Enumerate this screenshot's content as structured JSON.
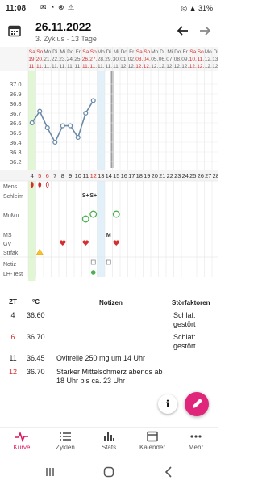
{
  "status": {
    "time": "11:08",
    "icons": "✉ ◔ ⊗ ⚠",
    "right": "◎ ▲ 31%"
  },
  "header": {
    "date": "26.11.2022",
    "subtitle": "3. Zyklus · 13 Tage"
  },
  "chart": {
    "weekdays": [
      "Sa",
      "So",
      "Mo",
      "Di",
      "Mi",
      "Do",
      "Fr",
      "Sa",
      "So",
      "Mo",
      "Di",
      "Mi",
      "Do",
      "Fr",
      "Sa",
      "So",
      "Mo",
      "Di",
      "Mi",
      "Do",
      "Fr",
      "Sa",
      "So",
      "Mo",
      "Di",
      "Mi"
    ],
    "dates": [
      "19.",
      "20.",
      "21.",
      "22.",
      "23.",
      "24.",
      "25.",
      "26.",
      "27.",
      "28.",
      "29.",
      "30.",
      "01.",
      "02.",
      "03.",
      "04.",
      "05.",
      "06.",
      "07.",
      "08.",
      "09.",
      "10.",
      "11.",
      "12.",
      "13.",
      "14."
    ],
    "months": [
      "11.",
      "11.",
      "11.",
      "11.",
      "11.",
      "11.",
      "11.",
      "11.",
      "11.",
      "11.",
      "11.",
      "11.",
      "12.",
      "12.",
      "12.",
      "12.",
      "12.",
      "12.",
      "12.",
      "12.",
      "12.",
      "12.",
      "12.",
      "12.",
      "12.",
      "12."
    ],
    "y_ticks": [
      "37.0",
      "36.9",
      "36.8",
      "36.7",
      "36.6",
      "36.5",
      "36.4",
      "36.3",
      "36.2"
    ],
    "cycle_days": [
      "4",
      "5",
      "6",
      "7",
      "8",
      "9",
      "10",
      "11",
      "12",
      "13",
      "14",
      "15",
      "16",
      "17",
      "18",
      "19",
      "20",
      "21",
      "22",
      "23",
      "24",
      "25",
      "26",
      "27",
      "28",
      "29"
    ],
    "temps": [
      36.6,
      36.72,
      36.55,
      36.4,
      36.57,
      36.57,
      36.45,
      36.7,
      36.83
    ],
    "row_labels": [
      "Mens",
      "Schleim",
      "MuMu",
      "MS",
      "GV",
      "Strfak",
      "Notiz",
      "LH-Test"
    ],
    "schleim_marks": [
      "S+",
      "S+"
    ],
    "ms_mark": "M"
  },
  "table": {
    "headers": {
      "zt": "ZT",
      "temp": "°C",
      "notes": "Notizen",
      "dist": "Störfaktoren"
    },
    "rows": [
      {
        "zt": "4",
        "temp": "36.60",
        "note": "",
        "dist": "Schlaf: gestört"
      },
      {
        "zt": "6",
        "temp": "36.70",
        "note": "",
        "dist": "Schlaf: gestört"
      },
      {
        "zt": "11",
        "temp": "36.45",
        "note": "Ovitrelle 250 mg um 14 Uhr",
        "dist": ""
      },
      {
        "zt": "12",
        "temp": "36.70",
        "note": "Starker Mittelschmerz abends ab 18 Uhr bis ca. 23 Uhr",
        "dist": ""
      }
    ]
  },
  "fab": {
    "info": "i"
  },
  "nav": [
    {
      "label": "Kurve"
    },
    {
      "label": "Zyklen"
    },
    {
      "label": "Stats"
    },
    {
      "label": "Kalender"
    },
    {
      "label": "Mehr"
    }
  ],
  "colors": {
    "accent": "#d81b60",
    "green_band": "#c8f0b0",
    "blue_band": "#d6e9f8",
    "line": "#6b8aa8"
  }
}
